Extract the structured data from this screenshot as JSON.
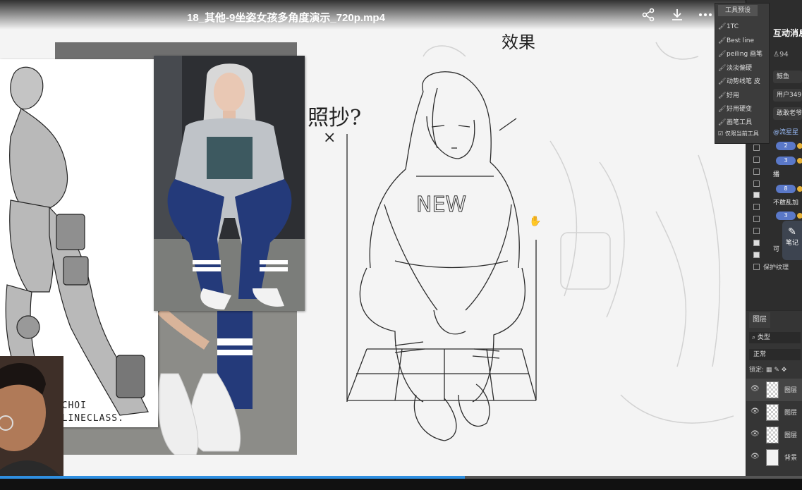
{
  "player": {
    "title": "18_其他-9坐姿女孩多角度演示_720p.mp4",
    "progress": 0.58,
    "icons": {
      "share": "share-icon",
      "download": "download-icon",
      "more": "more-icon",
      "minimize": "minimize-icon",
      "maximize": "maximize-icon",
      "close": "close-icon"
    }
  },
  "canvas": {
    "notes": {
      "zhaochao": "照抄?",
      "xiaoguo": "效果",
      "x_mark": "×"
    },
    "signature_line1": "TBCHOI",
    "signature_line2": "ONLINECLASS."
  },
  "brush_panel": {
    "tab": "工具预设",
    "items": [
      "1TC",
      "Best line",
      "peiling 画笔",
      "淡淡偏硬",
      "动势线笔 皮",
      "好用",
      "好用硬变",
      "画笔工具"
    ],
    "footer": "仅限当前工具"
  },
  "chat_panel": {
    "title": "互动消息",
    "count": "94",
    "chips": [
      "鲸鱼",
      "用户349",
      "敢敢老爷"
    ],
    "mention": "@流星星",
    "badges": [
      "2",
      "3",
      "8",
      "3"
    ],
    "lines": [
      "播",
      "不敢乱加",
      "可"
    ],
    "checkbox_label_last": "保护纹理"
  },
  "note_button": {
    "label": "笔记"
  },
  "layers_panel": {
    "tab": "图层",
    "filter": "类型",
    "mode": "正常",
    "lock_label": "锁定:",
    "layers": [
      {
        "name": "图层",
        "thumb": "checker",
        "selected": true
      },
      {
        "name": "图层",
        "thumb": "checker",
        "selected": false
      },
      {
        "name": "图层",
        "thumb": "checker",
        "selected": false
      },
      {
        "name": "背景",
        "thumb": "plain",
        "selected": false
      }
    ]
  }
}
